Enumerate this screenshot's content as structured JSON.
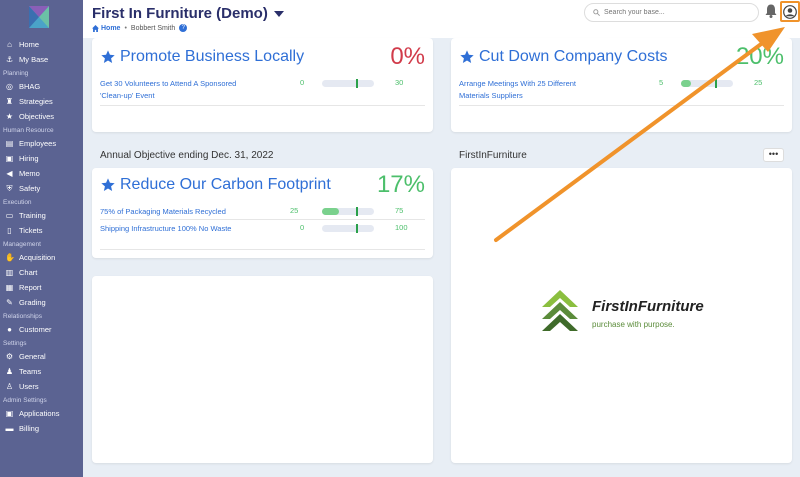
{
  "app": {
    "title": "First In Furniture (Demo)",
    "breadcrumb": {
      "home": "Home",
      "user": "Bobbert Smith"
    },
    "search_placeholder": "Search your base..."
  },
  "sidebar": {
    "items": [
      {
        "type": "item",
        "label": "Home",
        "icon": "home-icon",
        "glyph": "⌂"
      },
      {
        "type": "item",
        "label": "My Base",
        "icon": "anchor-icon",
        "glyph": "⚓"
      },
      {
        "type": "section",
        "label": "Planning"
      },
      {
        "type": "item",
        "label": "BHAG",
        "icon": "target-icon",
        "glyph": "◎"
      },
      {
        "type": "item",
        "label": "Strategies",
        "icon": "chess-icon",
        "glyph": "♜"
      },
      {
        "type": "item",
        "label": "Objectives",
        "icon": "star-icon",
        "glyph": "★"
      },
      {
        "type": "section",
        "label": "Human Resource"
      },
      {
        "type": "item",
        "label": "Employees",
        "icon": "id-card-icon",
        "glyph": "▤"
      },
      {
        "type": "item",
        "label": "Hiring",
        "icon": "id-badge-icon",
        "glyph": "▣"
      },
      {
        "type": "item",
        "label": "Memo",
        "icon": "megaphone-icon",
        "glyph": "◀"
      },
      {
        "type": "item",
        "label": "Safety",
        "icon": "shield-icon",
        "glyph": "⛨"
      },
      {
        "type": "section",
        "label": "Execution"
      },
      {
        "type": "item",
        "label": "Training",
        "icon": "chalkboard-icon",
        "glyph": "▭"
      },
      {
        "type": "item",
        "label": "Tickets",
        "icon": "document-icon",
        "glyph": "▯"
      },
      {
        "type": "section",
        "label": "Management"
      },
      {
        "type": "item",
        "label": "Acquisition",
        "icon": "handshake-icon",
        "glyph": "✋"
      },
      {
        "type": "item",
        "label": "Chart",
        "icon": "clipboard-icon",
        "glyph": "▥"
      },
      {
        "type": "item",
        "label": "Report",
        "icon": "report-icon",
        "glyph": "▦"
      },
      {
        "type": "item",
        "label": "Grading",
        "icon": "pen-icon",
        "glyph": "✎"
      },
      {
        "type": "section",
        "label": "Relationships"
      },
      {
        "type": "item",
        "label": "Customer",
        "icon": "comment-icon",
        "glyph": "●"
      },
      {
        "type": "section",
        "label": "Settings"
      },
      {
        "type": "item",
        "label": "General",
        "icon": "gear-icon",
        "glyph": "⚙"
      },
      {
        "type": "item",
        "label": "Teams",
        "icon": "team-icon",
        "glyph": "♟"
      },
      {
        "type": "item",
        "label": "Users",
        "icon": "user-icon",
        "glyph": "♙"
      },
      {
        "type": "section",
        "label": "Admin Settings"
      },
      {
        "type": "item",
        "label": "Applications",
        "icon": "apps-icon",
        "glyph": "▣"
      },
      {
        "type": "item",
        "label": "Billing",
        "icon": "credit-card-icon",
        "glyph": "▬"
      }
    ]
  },
  "objectives": {
    "promote": {
      "title": "Promote Business Locally",
      "percent": "0%",
      "color": "#d13b4a",
      "results": [
        {
          "label": "Get 30 Volunteers to Attend A Sponsored 'Clean-up' Event",
          "start": "0",
          "target": "30",
          "progress": 0
        }
      ]
    },
    "costs": {
      "title": "Cut Down Company Costs",
      "percent": "20%",
      "color": "#4cbf6b",
      "results": [
        {
          "label": "Arrange Meetings With 25 Different Materials Suppliers",
          "start": "5",
          "target": "25",
          "progress": 0.2
        }
      ]
    },
    "annual_label": "Annual Objective ending Dec. 31, 2022",
    "carbon": {
      "title": "Reduce Our Carbon Footprint",
      "percent": "17%",
      "color": "#4cbf6b",
      "results": [
        {
          "label": "75% of Packaging Materials Recycled",
          "start": "25",
          "target": "75",
          "progress": 0.33
        },
        {
          "label": "Shipping Infrastructure 100% No Waste",
          "start": "0",
          "target": "100",
          "progress": 0
        }
      ]
    }
  },
  "company_card": {
    "title": "FirstInFurniture",
    "more_label": "•••",
    "brand_name": "FirstInFurniture",
    "brand_tagline": "purchase with purpose."
  },
  "colors": {
    "sidebar": "#5b6392",
    "accent_blue": "#2f6fd6",
    "highlight_orange": "#f0932b",
    "success_green": "#4cbf6b",
    "danger_red": "#d13b4a"
  }
}
